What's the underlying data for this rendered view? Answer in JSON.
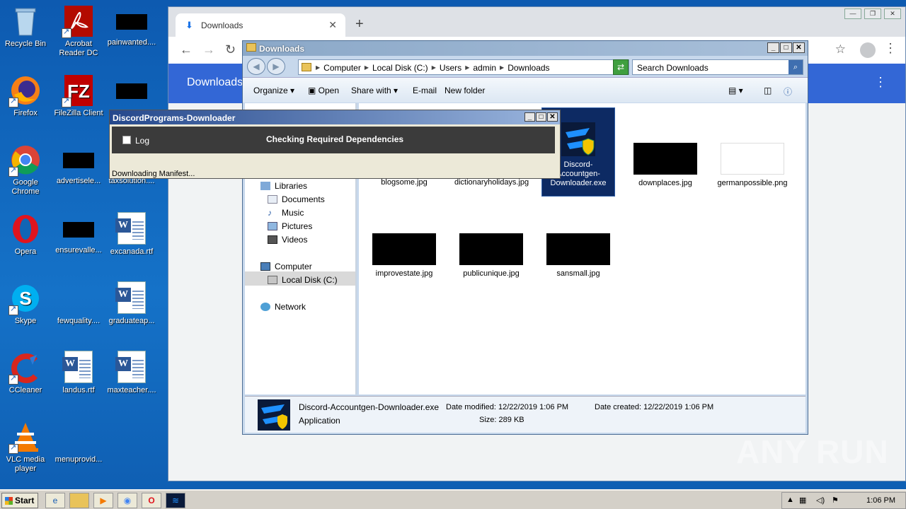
{
  "desktop": {
    "icons": [
      {
        "label": "Recycle Bin",
        "icon": "recycle-bin-icon"
      },
      {
        "label": "Acrobat Reader DC",
        "icon": "acrobat-icon"
      },
      {
        "label": "painwanted....",
        "icon": "black-file-icon"
      },
      {
        "label": "Firefox",
        "icon": "firefox-icon"
      },
      {
        "label": "FileZilla Client",
        "icon": "filezilla-icon"
      },
      {
        "label": "Google Chrome",
        "icon": "chrome-icon"
      },
      {
        "label": "advertisele...",
        "icon": "black-file-icon"
      },
      {
        "label": "taxsolution....",
        "icon": "black-file-icon"
      },
      {
        "label": "Opera",
        "icon": "opera-icon"
      },
      {
        "label": "ensurevalle...",
        "icon": "black-file-icon"
      },
      {
        "label": "excanada.rtf",
        "icon": "word-doc-icon"
      },
      {
        "label": "Skype",
        "icon": "skype-icon"
      },
      {
        "label": "fewquality....",
        "icon": "blank-file-icon"
      },
      {
        "label": "graduateap...",
        "icon": "word-doc-icon"
      },
      {
        "label": "CCleaner",
        "icon": "ccleaner-icon"
      },
      {
        "label": "landus.rtf",
        "icon": "word-doc-icon"
      },
      {
        "label": "maxteacher....",
        "icon": "word-doc-icon"
      },
      {
        "label": "VLC media player",
        "icon": "vlc-icon"
      },
      {
        "label": "menuprovid...",
        "icon": "blank-file-icon"
      }
    ]
  },
  "chrome": {
    "tab_title": "Downloads",
    "page_header": "Downloads"
  },
  "explorer": {
    "title": "Downloads",
    "breadcrumbs": [
      "Computer",
      "Local Disk (C:)",
      "Users",
      "admin",
      "Downloads"
    ],
    "search_placeholder": "Search Downloads",
    "toolbar": {
      "organize": "Organize",
      "open": "Open",
      "share_with": "Share with",
      "email": "E-mail",
      "new_folder": "New folder"
    },
    "nav": {
      "libraries": "Libraries",
      "documents": "Documents",
      "music": "Music",
      "pictures": "Pictures",
      "videos": "Videos",
      "computer": "Computer",
      "local_disk": "Local Disk (C:)",
      "network": "Network"
    },
    "files": [
      {
        "name": "blogsome.jpg"
      },
      {
        "name": "dictionaryholidays.jpg"
      },
      {
        "name": "Discord-Accountgen-Downloader.exe"
      },
      {
        "name": "downplaces.jpg"
      },
      {
        "name": "germanpossible.png"
      },
      {
        "name": "improvestate.jpg"
      },
      {
        "name": "publicunique.jpg"
      },
      {
        "name": "sansmall.jpg"
      }
    ],
    "details": {
      "filename": "Discord-Accountgen-Downloader.exe",
      "type": "Application",
      "date_modified_label": "Date modified:",
      "date_modified": "12/22/2019 1:06 PM",
      "date_created_label": "Date created:",
      "date_created": "12/22/2019 1:06 PM",
      "size_label": "Size:",
      "size": "289 KB"
    }
  },
  "discord_dialog": {
    "title": "DiscordPrograms-Downloader",
    "log_label": "Log",
    "status": "Checking Required Dependencies",
    "progress_text": "Downloading Manifest..."
  },
  "taskbar": {
    "start_label": "Start",
    "clock": "1:06 PM"
  },
  "watermark": "ANY RUN"
}
